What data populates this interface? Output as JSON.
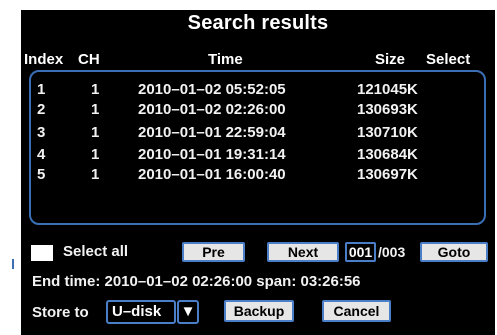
{
  "dialog": {
    "title": "Search results",
    "columns": {
      "index": "Index",
      "ch": "CH",
      "time": "Time",
      "size": "Size",
      "select": "Select"
    },
    "rows": [
      {
        "index": "1",
        "ch": "1",
        "time": "2010–01–02 05:52:05",
        "size": "121045K"
      },
      {
        "index": "2",
        "ch": "1",
        "time": "2010–01–02 02:26:00",
        "size": "130693K"
      },
      {
        "index": "3",
        "ch": "1",
        "time": "2010–01–01 22:59:04",
        "size": "130710K"
      },
      {
        "index": "4",
        "ch": "1",
        "time": "2010–01–01 19:31:14",
        "size": "130684K"
      },
      {
        "index": "5",
        "ch": "1",
        "time": "2010–01–01 16:00:40",
        "size": "130697K"
      }
    ],
    "select_all_label": "Select all",
    "pre_label": "Pre",
    "next_label": "Next",
    "page_current": "001",
    "page_total": "/003",
    "goto_label": "Goto",
    "end_time_line": "End time: 2010–01–02 02:26:00  span: 03:26:56",
    "store_to_label": "Store to",
    "store_value": "U–disk",
    "store_arrow": "▼",
    "backup_label": "Backup",
    "cancel_label": "Cancel"
  },
  "colors": {
    "background": "#000000",
    "accent_border": "#4a7fc8",
    "button_face": "#e6e6e6"
  }
}
